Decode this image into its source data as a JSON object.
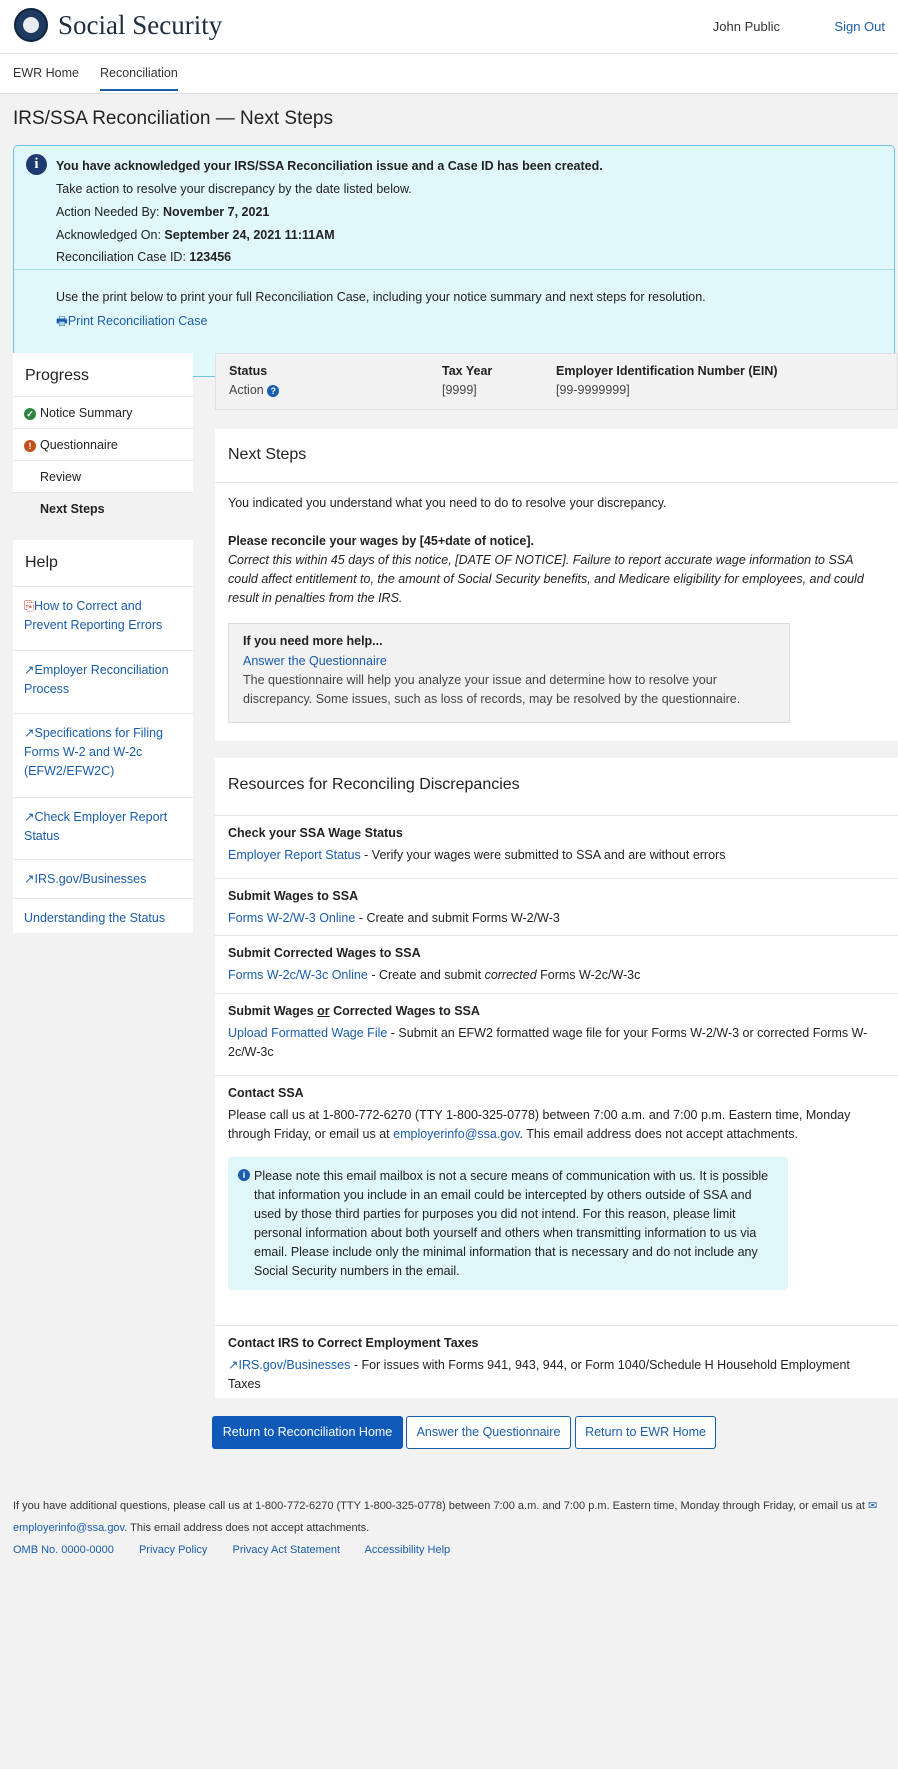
{
  "header": {
    "brand": "Social Security",
    "user": "John Public",
    "sign_out": "Sign Out"
  },
  "nav": {
    "tabs": [
      "EWR Home",
      "Reconciliation"
    ]
  },
  "page_title": "IRS/SSA Reconciliation — Next Steps",
  "alert": {
    "title": "You have acknowledged your IRS/SSA Reconciliation issue and a Case ID has been created.",
    "line1": "Take action to resolve your discrepancy by the date listed below.",
    "action_label": "Action Needed By:",
    "action_value": "November 7, 2021",
    "ack_label": "Acknowledged On:",
    "ack_value": "September 24, 2021 11:11AM",
    "case_label": "Reconciliation Case ID:",
    "case_value": "123456",
    "print_text": "Use the print below to print your full Reconciliation Case, including your notice summary and next steps for resolution.",
    "print_link": "Print Reconciliation Case"
  },
  "progress": {
    "title": "Progress",
    "items": [
      "Notice Summary",
      "Questionnaire",
      "Review",
      "Next Steps"
    ]
  },
  "help": {
    "title": "Help",
    "items": [
      "How to Correct and Prevent Reporting Errors",
      "Employer Reconciliation Process",
      "Specifications for Filing Forms W-2 and W-2c (EFW2/EFW2C)",
      "Check Employer Report Status",
      "IRS.gov/Businesses",
      "Understanding the Status"
    ]
  },
  "status": {
    "status_label": "Status",
    "status_value": "Action",
    "tax_year_label": "Tax Year",
    "tax_year_value": "[9999]",
    "ein_label": "Employer Identification Number (EIN)",
    "ein_value": "[99-9999999]"
  },
  "next_steps": {
    "title": "Next Steps",
    "intro": "You indicated you understand what you need to do to resolve your discrepancy.",
    "reconcile_heading": "Please reconcile your wages by [45+date of notice].",
    "reconcile_text": "Correct this within 45 days of this notice, [DATE OF NOTICE].  Failure to report accurate wage information to SSA could affect entitlement to, the amount of Social Security benefits, and Medicare eligibility for employees, and could result in penalties from the IRS.",
    "help_heading": "If you need more help...",
    "help_link": "Answer the Questionnaire",
    "help_text": "The questionnaire will help you analyze your issue and determine how to resolve your discrepancy. Some issues, such as loss of records, may be resolved by the questionnaire."
  },
  "resources": {
    "title": "Resources for Reconciling Discrepancies",
    "r1_title": "Check your SSA Wage Status",
    "r1_link": "Employer Report Status",
    "r1_text": " - Verify your wages were submitted to SSA and are without errors",
    "r2_title": "Submit Wages to SSA",
    "r2_link": "Forms  W-2/W-3 Online",
    "r2_text": " - Create and submit Forms W-2/W-3",
    "r3_title": "Submit Corrected Wages to SSA",
    "r3_link": "Forms  W-2c/W-3c Online",
    "r3_text_a": " - Create and submit ",
    "r3_text_em": "corrected",
    "r3_text_b": " Forms W-2c/W-3c",
    "r4_title_a": "Submit Wages ",
    "r4_title_u": "or",
    "r4_title_b": " Corrected Wages to SSA",
    "r4_link": "Upload Formatted Wage File",
    "r4_text": " - Submit an EFW2 formatted wage file for your Forms W-2/W-3 or corrected Forms W-2c/W-3c",
    "r5_title": "Contact SSA",
    "r5_text_a": "Please call us at 1-800-772-6270 (TTY 1-800-325-0778) between 7:00 a.m. and 7:00 p.m. Eastern time, Monday through Friday, or email us at ",
    "r5_email": "employerinfo@ssa.gov",
    "r5_text_b": ". This email address does not accept attachments.",
    "notice": "Please note this email mailbox is not a secure means of communication with us. It is possible that information you include in an email could be intercepted by others outside of SSA and used by those third parties for purposes you did not intend. For this reason, please limit personal information about both yourself and others when transmitting information to us via email.  Please include only the minimal information that is necessary and do not include any Social Security numbers in the email.",
    "r6_title": "Contact IRS to Correct Employment Taxes",
    "r6_link": "IRS.gov/Businesses",
    "r6_text": " - For issues with Forms 941, 943, 944, or Form 1040/Schedule H Household Employment Taxes"
  },
  "buttons": {
    "primary": "Return to Reconciliation Home",
    "questionnaire": "Answer the Questionnaire",
    "ewr": "Return to EWR Home"
  },
  "footer": {
    "text_a": "If you have additional questions, please call us at 1-800-772-6270 (TTY 1-800-325-0778) between 7:00 a.m. and 7:00 p.m. Eastern time, Monday through Friday, or email us at ",
    "email": "employerinfo@ssa.gov",
    "text_b": ". This email address does not accept attachments.",
    "links": [
      "OMB No. 0000-0000",
      "Privacy Policy",
      "Privacy Act Statement",
      "Accessibility Help"
    ]
  }
}
